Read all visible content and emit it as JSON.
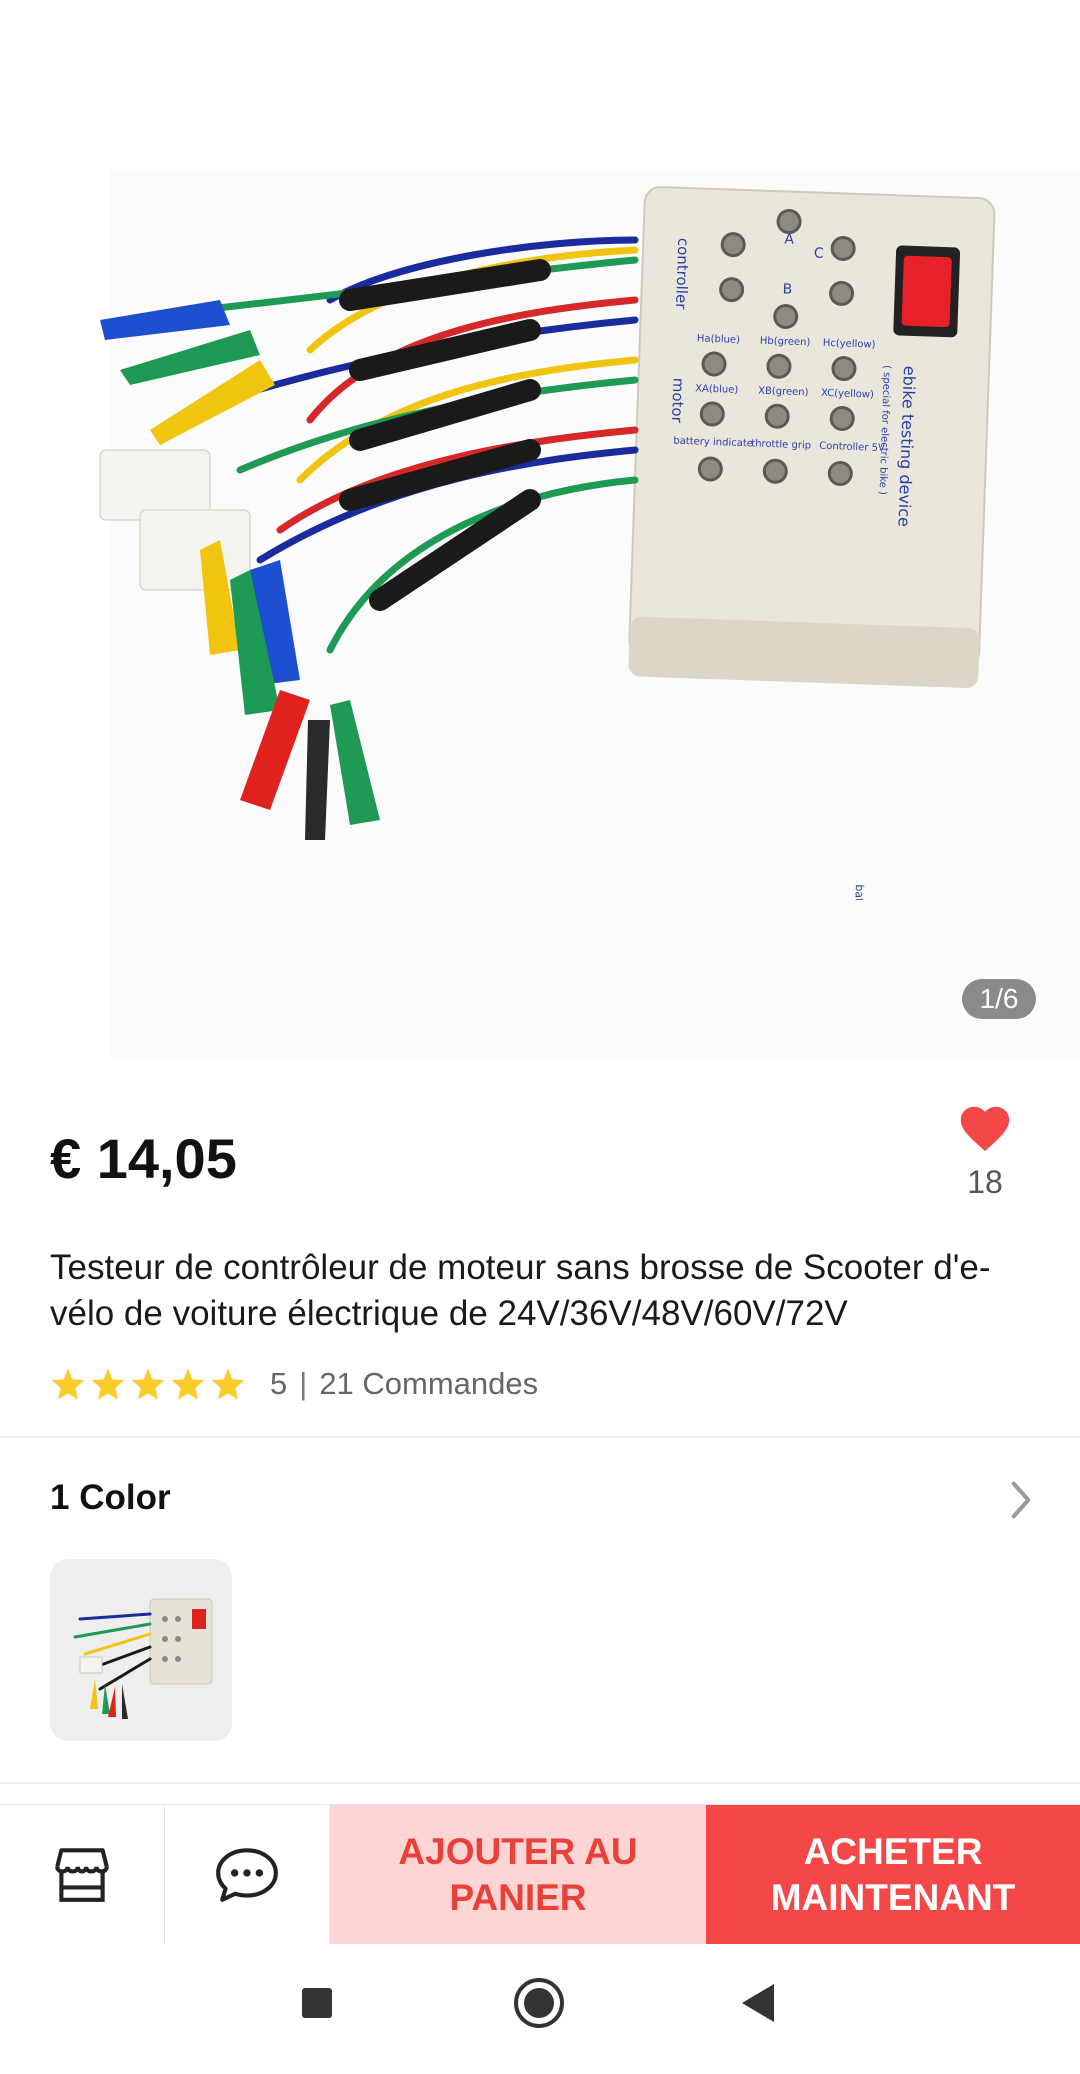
{
  "gallery": {
    "image_alt": "Testeur de contrôleur de moteur",
    "page_indicator": "1/6",
    "device_labels": {
      "controller": "controller",
      "motor": "motor",
      "battery_switch": "battery switch",
      "ebike_testing_device": "ebike testing device",
      "special_note": "( special for electric bike )",
      "ha": "Ha(blue)",
      "hb": "Hb(green)",
      "hc": "Hc(yellow)",
      "xa": "XA(blue)",
      "xb": "XB(green)",
      "xc": "XC(yellow)",
      "battery_indicate": "battery indicate",
      "throttle_grip": "throttle grip",
      "controller_5v": "Controller 5V",
      "a": "A",
      "b": "B",
      "c": "C"
    }
  },
  "product": {
    "price": "€ 14,05",
    "wishlist_count": "18",
    "title": "Testeur de contrôleur de moteur sans brosse de Scooter d'e-vélo de voiture électrique de 24V/36V/48V/60V/72V",
    "rating": "5",
    "separator": "|",
    "orders": "21 Commandes",
    "stars": 5
  },
  "variants": {
    "heading": "1 Color"
  },
  "actions": {
    "store_icon": "store-icon",
    "chat_icon": "chat-icon",
    "add_to_cart": "AJOUTER AU PANIER",
    "buy_now": "ACHETER MAINTENANT"
  },
  "colors": {
    "accent": "#f44848",
    "accent_light": "#ffd4d4",
    "accent_text": "#e8413a",
    "star": "#fbcd2b",
    "heart": "#f44848"
  },
  "navbar": {
    "icons": [
      "square-icon",
      "home-circle-icon",
      "back-triangle-icon"
    ]
  }
}
